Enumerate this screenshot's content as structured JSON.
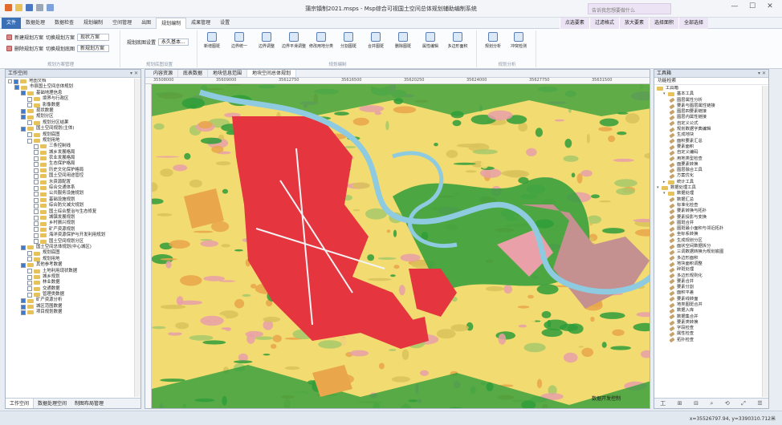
{
  "window": {
    "title": "蒲宗镇制2021.msps - Msp综合可视国土空间总体规划辅助编制系统",
    "search_placeholder": "告诉我您想要做什么",
    "controls": [
      "—",
      "☐",
      "✕"
    ]
  },
  "ribbon_tabs": [
    "文件",
    "数据处理",
    "数据检查",
    "规划编制",
    "空间管理",
    "出图",
    "规划编制",
    "成果管理",
    "设置"
  ],
  "ribbon_active_index": 6,
  "ribbon_right_tabs": [
    "点选要素",
    "过滤格式",
    "放大要素",
    "选择面积",
    "全部选择"
  ],
  "ribbon": {
    "group1": {
      "label": "规划方案管理",
      "row1_btn": "新建规划方案",
      "row1_btn2": "切换规划方案",
      "row1_dropdown": "现状方案",
      "row2_btn": "删除规划方案",
      "row2_btn2": "切换规划底图",
      "row2_dropdown": "新规划方案"
    },
    "group2": {
      "label": "规划底图设置",
      "row1_label": "规划底图设置",
      "row1_dropdown": "永久基本..."
    },
    "group3": {
      "label": "规划编制",
      "buttons": [
        "新增图斑",
        "边界统一",
        "边界调整",
        "边界平滑调整",
        "修改用地分类",
        "分割图斑",
        "合并图斑",
        "删除图斑",
        "属性编辑",
        "多边形面积"
      ]
    },
    "group4": {
      "label": "规划分析",
      "buttons": [
        "规划分析",
        "冲突检测"
      ]
    }
  },
  "left_panel": {
    "title": "工作空间",
    "tree": [
      {
        "d": 0,
        "t": "地图文档",
        "k": "folder"
      },
      {
        "d": 1,
        "t": "市县国土空间总体规划",
        "k": "cb"
      },
      {
        "d": 2,
        "t": "基础地理信息",
        "k": "cb"
      },
      {
        "d": 3,
        "t": "境界与行政区",
        "k": "cb"
      },
      {
        "d": 3,
        "t": "影像数据",
        "k": "cb"
      },
      {
        "d": 2,
        "t": "现状数据",
        "k": "cb"
      },
      {
        "d": 2,
        "t": "规划分区",
        "k": "cb"
      },
      {
        "d": 3,
        "t": "规划分区结果",
        "k": "cb"
      },
      {
        "d": 2,
        "t": "国土空间规划(主体)",
        "k": "cb"
      },
      {
        "d": 3,
        "t": "规划底图",
        "k": "cb"
      },
      {
        "d": 3,
        "t": "规划用地",
        "k": "cb"
      },
      {
        "d": 4,
        "t": "三条控制线",
        "k": "cb"
      },
      {
        "d": 4,
        "t": "城乡发展格局",
        "k": "cb"
      },
      {
        "d": 4,
        "t": "农业发展格局",
        "k": "cb"
      },
      {
        "d": 4,
        "t": "生态保护格局",
        "k": "cb"
      },
      {
        "d": 4,
        "t": "历史文化保护格局",
        "k": "cb"
      },
      {
        "d": 4,
        "t": "国土空间用途管控",
        "k": "cb"
      },
      {
        "d": 4,
        "t": "水资源配置",
        "k": "cb"
      },
      {
        "d": 4,
        "t": "综合交通体系",
        "k": "cb"
      },
      {
        "d": 4,
        "t": "公共服务设施规划",
        "k": "cb"
      },
      {
        "d": 4,
        "t": "基础设施规划",
        "k": "cb"
      },
      {
        "d": 4,
        "t": "综合防灾减灾规划",
        "k": "cb"
      },
      {
        "d": 4,
        "t": "国土综合整治与生态修复",
        "k": "cb"
      },
      {
        "d": 4,
        "t": "城镇发展规划",
        "k": "cb"
      },
      {
        "d": 4,
        "t": "乡村振兴规划",
        "k": "cb"
      },
      {
        "d": 4,
        "t": "矿产资源规划",
        "k": "cb"
      },
      {
        "d": 4,
        "t": "海洋资源保护与开发利用规划",
        "k": "cb"
      },
      {
        "d": 4,
        "t": "国土空间规划分区",
        "k": "cb"
      },
      {
        "d": 2,
        "t": "国土空间总体规划(中心城区)",
        "k": "cb"
      },
      {
        "d": 3,
        "t": "规划底图",
        "k": "cb"
      },
      {
        "d": 3,
        "t": "规划用地",
        "k": "cb"
      },
      {
        "d": 2,
        "t": "其他参考数据",
        "k": "cb"
      },
      {
        "d": 3,
        "t": "土地利用现状数据",
        "k": "cb"
      },
      {
        "d": 3,
        "t": "城乡规划",
        "k": "cb"
      },
      {
        "d": 3,
        "t": "林业数据",
        "k": "cb"
      },
      {
        "d": 3,
        "t": "交通数据",
        "k": "cb"
      },
      {
        "d": 3,
        "t": "管理类数据",
        "k": "cb"
      },
      {
        "d": 2,
        "t": "矿产资源分析",
        "k": "cb"
      },
      {
        "d": 2,
        "t": "城区范围数据",
        "k": "cb"
      },
      {
        "d": 2,
        "t": "项目规划数据",
        "k": "cb"
      }
    ],
    "tabs": [
      "工作空间",
      "数据处理空间",
      "制图布局管理"
    ]
  },
  "map_window": {
    "tabs": [
      "内容资源",
      "底表数据",
      "地块信息范围",
      "地块空间总体规划"
    ],
    "ruler_ticks": [
      "35508000",
      "35609000",
      "35612750",
      "35616500",
      "35620250",
      "35624000",
      "35627750",
      "35631500"
    ],
    "note": "数据开发控制"
  },
  "right_panel": {
    "title": "工具箱",
    "subtitle": "功能检索",
    "tree": [
      {
        "d": 0,
        "t": "工具箱",
        "k": "folder"
      },
      {
        "d": 1,
        "t": "基本工具",
        "k": "folder",
        "tg": "▾"
      },
      {
        "d": 2,
        "t": "图层属性分析",
        "k": "tool"
      },
      {
        "d": 2,
        "t": "要素与图层属性链接",
        "k": "tool"
      },
      {
        "d": 2,
        "t": "图层四要素链接",
        "k": "tool"
      },
      {
        "d": 2,
        "t": "图层内属性链接",
        "k": "tool"
      },
      {
        "d": 2,
        "t": "自定义公式",
        "k": "tool"
      },
      {
        "d": 2,
        "t": "规划数据字典编辑",
        "k": "tool"
      },
      {
        "d": 2,
        "t": "生成地块",
        "k": "tool"
      },
      {
        "d": 2,
        "t": "面积要素汇总",
        "k": "tool"
      },
      {
        "d": 2,
        "t": "要素面积",
        "k": "tool"
      },
      {
        "d": 2,
        "t": "自定义编码",
        "k": "tool"
      },
      {
        "d": 2,
        "t": "用地类型检查",
        "k": "tool"
      },
      {
        "d": 2,
        "t": "面要素转换",
        "k": "tool"
      },
      {
        "d": 2,
        "t": "图层融合工具",
        "k": "tool"
      },
      {
        "d": 2,
        "t": "方案优化",
        "k": "tool"
      },
      {
        "d": 1,
        "t": "统计工具",
        "k": "folder",
        "tg": "▸"
      },
      {
        "d": 0,
        "t": "数据处理工具",
        "k": "folder",
        "tg": "▾"
      },
      {
        "d": 1,
        "t": "数据处理",
        "k": "folder",
        "tg": "▾"
      },
      {
        "d": 2,
        "t": "数据汇总",
        "k": "tool"
      },
      {
        "d": 2,
        "t": "标准化检查",
        "k": "tool"
      },
      {
        "d": 2,
        "t": "要素转换与拓扑",
        "k": "tool"
      },
      {
        "d": 2,
        "t": "要素投影与变换",
        "k": "tool"
      },
      {
        "d": 2,
        "t": "图斑合并",
        "k": "tool"
      },
      {
        "d": 2,
        "t": "图斑最小面积与邻近拓扑",
        "k": "tool"
      },
      {
        "d": 2,
        "t": "坐标系转换",
        "k": "tool"
      },
      {
        "d": 2,
        "t": "生成规划分区",
        "k": "tool"
      },
      {
        "d": 2,
        "t": "面状空间数据拆分",
        "k": "tool"
      },
      {
        "d": 2,
        "t": "三调数据转换为规划底图",
        "k": "tool"
      },
      {
        "d": 2,
        "t": "多边形面积",
        "k": "tool"
      },
      {
        "d": 2,
        "t": "地块面积调整",
        "k": "tool"
      },
      {
        "d": 2,
        "t": "碎斑处理",
        "k": "tool"
      },
      {
        "d": 2,
        "t": "多边形规则化",
        "k": "tool"
      },
      {
        "d": 2,
        "t": "要素合并",
        "k": "tool"
      },
      {
        "d": 2,
        "t": "要素分割",
        "k": "tool"
      },
      {
        "d": 2,
        "t": "面积平差",
        "k": "tool"
      },
      {
        "d": 2,
        "t": "要素线转面",
        "k": "tool"
      },
      {
        "d": 2,
        "t": "地类图斑合并",
        "k": "tool"
      },
      {
        "d": 2,
        "t": "数据入库",
        "k": "tool"
      },
      {
        "d": 2,
        "t": "数据集合并",
        "k": "tool"
      },
      {
        "d": 2,
        "t": "要素类转换",
        "k": "tool"
      },
      {
        "d": 2,
        "t": "字段检查",
        "k": "tool"
      },
      {
        "d": 2,
        "t": "属性检查",
        "k": "tool"
      },
      {
        "d": 2,
        "t": "拓扑检查",
        "k": "tool"
      }
    ],
    "bottom_tools": [
      "工",
      "⊞",
      "⊟",
      "⌕",
      "⟲",
      "⤢",
      "☰"
    ]
  },
  "status": {
    "coordinate": "x=35526797.94, y=3390310.712米"
  },
  "colors": {
    "urban": "#e5353f",
    "farm": "#f2dc72",
    "forest": "#2f9e3a",
    "river": "#8fcbe0",
    "pink": "#e9a0a8",
    "orange": "#e9a64a"
  }
}
